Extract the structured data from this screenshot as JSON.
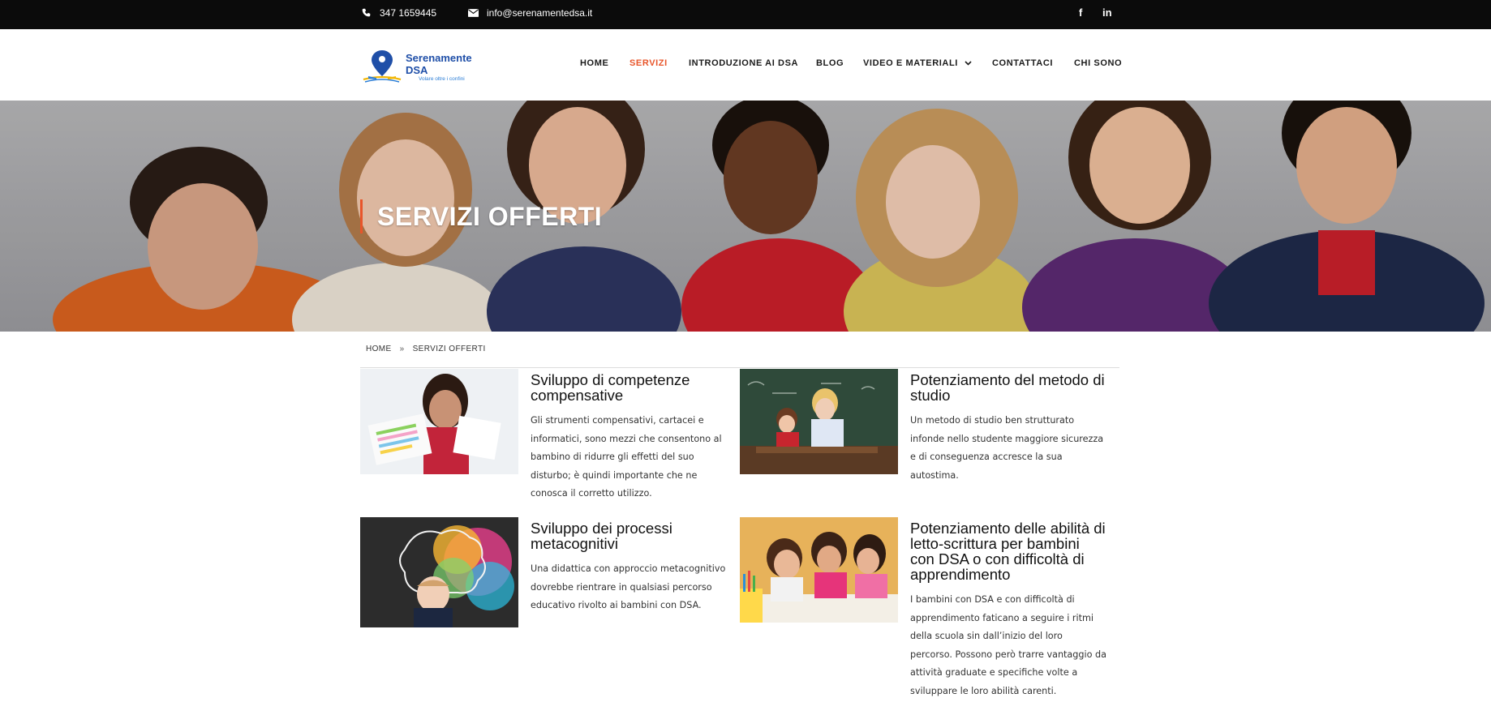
{
  "topbar": {
    "phone": "347 1659445",
    "email": "info@serenamentedsa.it",
    "social": [
      {
        "icon": "facebook-icon",
        "glyph": "f"
      },
      {
        "icon": "linkedin-icon",
        "glyph": "in"
      }
    ]
  },
  "logo": {
    "title": "Serenamente DSA",
    "tagline": "Volare oltre i confini"
  },
  "nav": {
    "items": [
      {
        "label": "HOME"
      },
      {
        "label": "SERVIZI",
        "active": true
      },
      {
        "label": "INTRODUZIONE AI DSA"
      },
      {
        "label": "BLOG"
      },
      {
        "label": "VIDEO E MATERIALI",
        "dropdown": true
      },
      {
        "label": "CONTATTACI"
      },
      {
        "label": "CHI SONO"
      }
    ]
  },
  "hero": {
    "title": "SERVIZI OFFERTI"
  },
  "breadcrumb": {
    "home": "HOME",
    "separator": "»",
    "current": "SERVIZI OFFERTI"
  },
  "services": [
    {
      "title": "Sviluppo di competenze compensative",
      "text": "Gli strumenti compensativi, cartacei e informatici, sono mezzi che consentono al bambino di ridurre gli effetti del suo disturbo; è quindi importante che ne conosca il corretto utilizzo."
    },
    {
      "title": "Potenziamento del metodo di studio",
      "text": "Un metodo di studio ben strutturato infonde nello studente maggiore sicurezza e di conseguenza accresce la sua autostima."
    },
    {
      "title": "Sviluppo dei processi metacognitivi",
      "text": "Una didattica con approccio metacognitivo dovrebbe rientrare in qualsiasi percorso educativo rivolto ai bambini con DSA."
    },
    {
      "title": "Potenziamento delle abilità di letto-scrittura per bambini con DSA o con difficoltà di apprendimento",
      "text": "I bambini con DSA e con difficoltà di apprendimento faticano a seguire i ritmi della scuola sin dall’inizio del loro percorso. Possono però trarre vantaggio da attività graduate e specifiche volte a sviluppare le loro abilità carenti."
    }
  ],
  "colors": {
    "accent": "#e8552a",
    "topbar": "#0b0b0b",
    "logo_blue": "#1f4fa8"
  }
}
